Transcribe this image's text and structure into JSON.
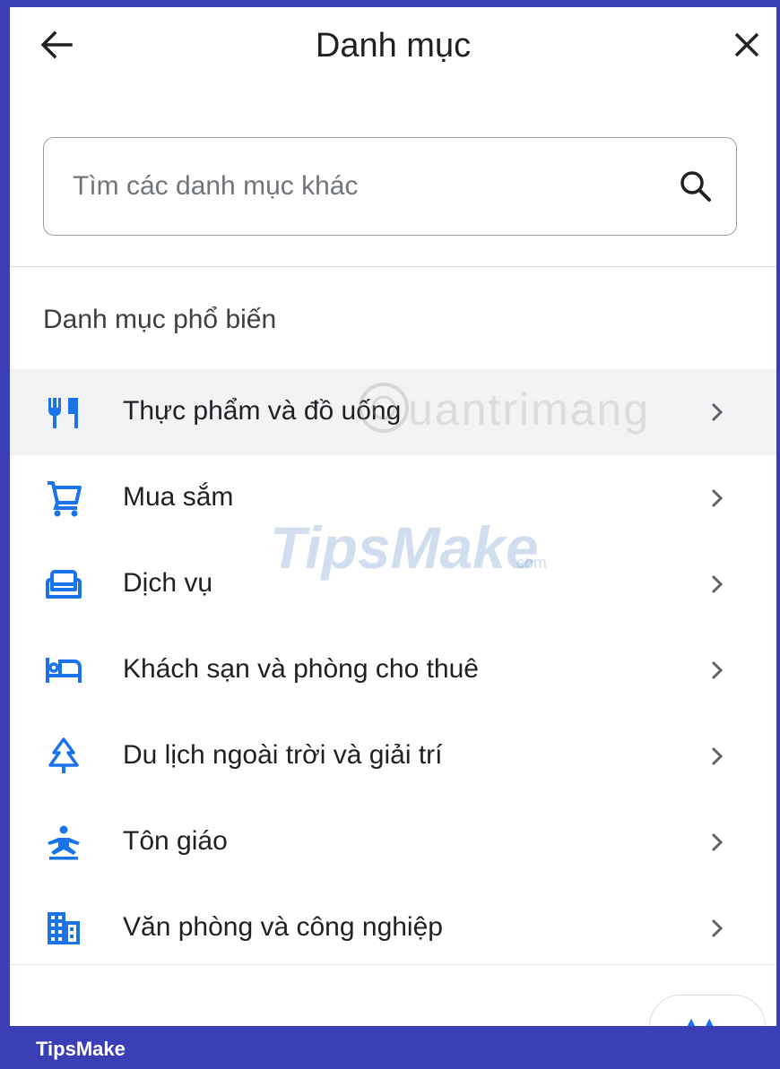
{
  "header": {
    "title": "Danh mục"
  },
  "search": {
    "placeholder": "Tìm các danh mục khác"
  },
  "section": {
    "title": "Danh mục phổ biến"
  },
  "categories": [
    {
      "label": "Thực phẩm và đồ uống",
      "icon": "restaurant-icon"
    },
    {
      "label": "Mua sắm",
      "icon": "shopping-cart-icon"
    },
    {
      "label": "Dịch vụ",
      "icon": "sofa-icon"
    },
    {
      "label": "Khách sạn và phòng cho thuê",
      "icon": "hotel-bed-icon"
    },
    {
      "label": "Du lịch ngoài trời và giải trí",
      "icon": "tree-icon"
    },
    {
      "label": "Tôn giáo",
      "icon": "meditation-icon"
    },
    {
      "label": "Văn phòng và công nghiệp",
      "icon": "building-icon"
    }
  ],
  "watermarks": {
    "quantrimang": "uantrimang",
    "tips": "TipsMake",
    "tips_com": ".com"
  },
  "footer": {
    "brand": "TipsMake"
  },
  "colors": {
    "accent": "#1a73e8",
    "frame": "#3b3fb6",
    "highlight_row": "#f1f3f4"
  }
}
